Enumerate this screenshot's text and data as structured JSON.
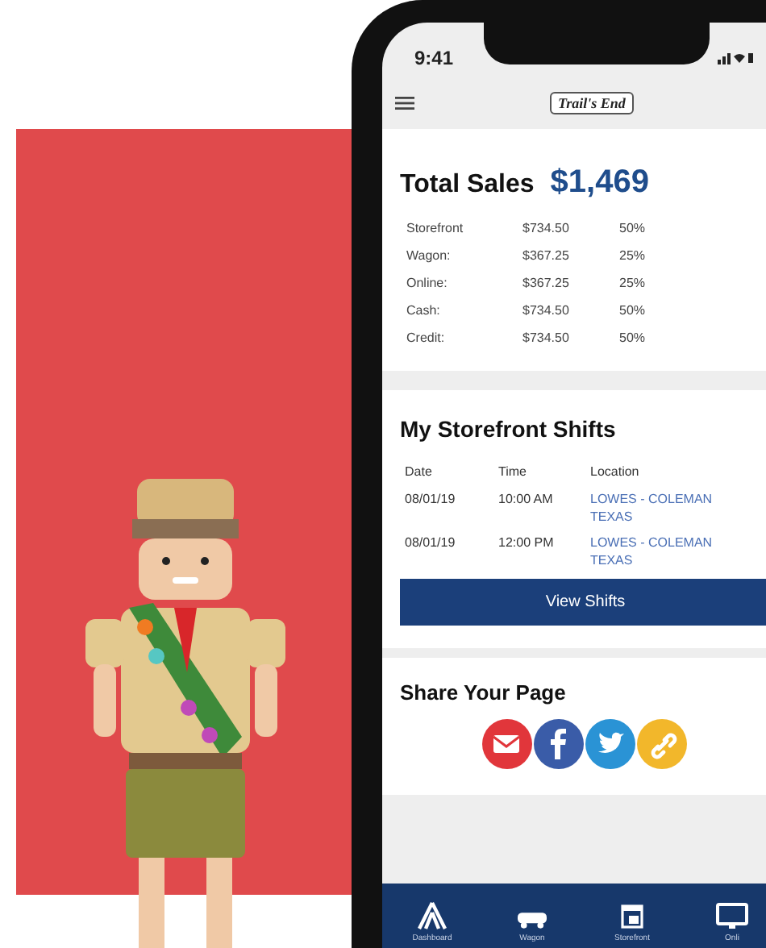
{
  "status_bar": {
    "time": "9:41"
  },
  "header": {
    "logo": "Trail's End"
  },
  "sales": {
    "title": "Total Sales",
    "total": "$1,469",
    "rows": [
      {
        "channel": "Storefront",
        "amount": "$734.50",
        "share": "50%"
      },
      {
        "channel": "Wagon:",
        "amount": "$367.25",
        "share": "25%"
      },
      {
        "channel": "Online:",
        "amount": "$367.25",
        "share": "25%"
      },
      {
        "channel": "Cash:",
        "amount": "$734.50",
        "share": "50%"
      },
      {
        "channel": "Credit:",
        "amount": "$734.50",
        "share": "50%"
      }
    ]
  },
  "shifts": {
    "title": "My Storefront Shifts",
    "columns": [
      "Date",
      "Time",
      "Location"
    ],
    "rows": [
      {
        "date": "08/01/19",
        "time": "10:00 AM",
        "location": "LOWES - COLEMAN TEXAS"
      },
      {
        "date": "08/01/19",
        "time": "12:00 PM",
        "location": "LOWES - COLEMAN TEXAS"
      }
    ],
    "button": "View Shifts"
  },
  "share": {
    "title": "Share Your Page",
    "buttons": [
      {
        "kind": "email"
      },
      {
        "kind": "facebook"
      },
      {
        "kind": "twitter"
      },
      {
        "kind": "link"
      }
    ]
  },
  "tab_bar": [
    {
      "label": "Dashboard",
      "kind": "tent"
    },
    {
      "label": "Wagon",
      "kind": "wagon"
    },
    {
      "label": "Storefront",
      "kind": "store"
    },
    {
      "label": "Onli",
      "kind": "monitor"
    }
  ]
}
